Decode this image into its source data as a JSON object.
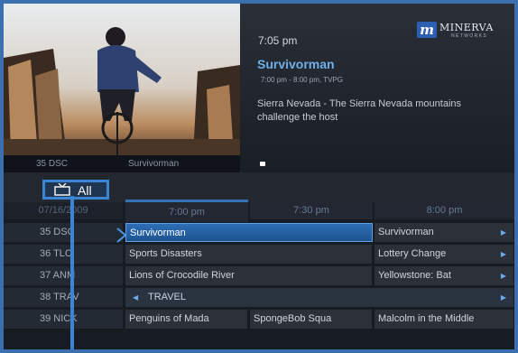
{
  "video": {
    "channel": "35  DSC",
    "program": "Survivorman"
  },
  "info": {
    "logo": {
      "badge": "m",
      "word": "MINERVA",
      "sub": "NETWORKS"
    },
    "clock": "7:05 pm",
    "title": "Survivorman",
    "time_rating": "7:00 pm - 8:00 pm, TVPG",
    "description": "Sierra Nevada - The Sierra Nevada mountains challenge the host",
    "icon": "info-chip-icon"
  },
  "filter": {
    "label": "All",
    "icon": "tv-icon"
  },
  "guide": {
    "date": "07/16/2009",
    "times": [
      "7:00 pm",
      "7:30 pm",
      "8:00 pm"
    ],
    "rows": [
      {
        "channel": "35 DSC",
        "programs": [
          "Survivorman",
          "Survivorman"
        ]
      },
      {
        "channel": "36 TLC",
        "programs": [
          "Sports Disasters",
          "Lottery Change"
        ]
      },
      {
        "channel": "37 ANM",
        "programs": [
          "Lions of Crocodile River",
          "Yellowstone: Bat"
        ]
      },
      {
        "channel": "38 TRAV",
        "programs": [
          "TRAVEL"
        ]
      },
      {
        "channel": "39 NICK",
        "programs": [
          "Penguins of Mada",
          "SpongeBob Squa",
          "Malcolm in the Middle"
        ]
      }
    ],
    "more_icon": "right-arrow-icon",
    "travel_icon": "left-arrow-icon"
  },
  "colors": {
    "frame": "#3b6fb0",
    "selected": "#2e6fb8",
    "title_accent": "#6fb0ea"
  }
}
